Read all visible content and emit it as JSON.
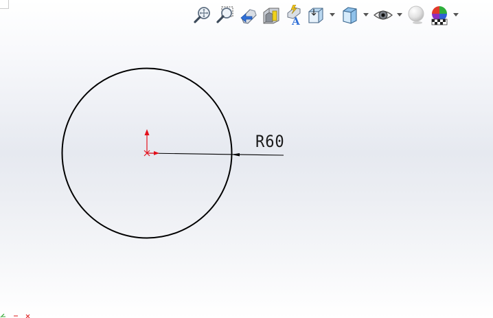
{
  "sketch": {
    "circle_dimension_label": "R60"
  },
  "toolbar": {
    "buttons": [
      {
        "icon": "zoom-to-fit-icon"
      },
      {
        "icon": "zoom-to-area-icon"
      },
      {
        "icon": "previous-view-icon"
      },
      {
        "icon": "section-view-icon"
      },
      {
        "icon": "dynamic-annotation-views-icon"
      },
      {
        "icon": "view-orientation-icon",
        "dropdown": true
      },
      {
        "icon": "display-style-icon",
        "dropdown": true
      },
      {
        "icon": "hide-show-items-icon",
        "dropdown": true
      },
      {
        "icon": "edit-appearance-icon"
      },
      {
        "icon": "apply-scene-icon",
        "dropdown": true
      }
    ]
  },
  "colors": {
    "sketch_line": "#000000",
    "origin": "#e3101c"
  }
}
